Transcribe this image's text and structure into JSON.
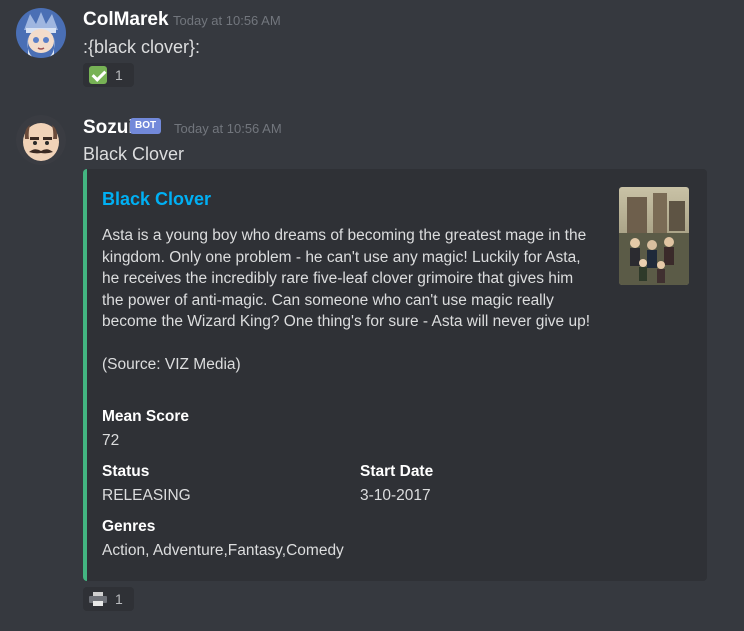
{
  "messages": [
    {
      "username": "ColMarek",
      "timestamp": "Today at 10:56 AM",
      "content": ":{black clover}:",
      "reaction": {
        "icon": "check-mark-button-icon",
        "count": "1"
      }
    },
    {
      "username": "Sozui",
      "bot_tag": "BOT",
      "timestamp": "Today at 10:56 AM",
      "content": "Black Clover",
      "embed": {
        "accent_color": "#43b581",
        "title": "Black Clover",
        "description": "Asta is a young boy who dreams of becoming the greatest mage in the kingdom. Only one problem - he can't use any magic! Luckily for Asta, he receives the incredibly rare five-leaf clover grimoire that gives him the power of anti-magic. Can someone who can't use magic really become the Wizard King? One thing's for sure - Asta will never give up!",
        "source": "(Source: VIZ Media)",
        "fields": {
          "mean_score": {
            "name": "Mean Score",
            "value": "72"
          },
          "status": {
            "name": "Status",
            "value": "RELEASING"
          },
          "start_date": {
            "name": "Start Date",
            "value": "3-10-2017"
          },
          "genres": {
            "name": "Genres",
            "value": "Action, Adventure,Fantasy,Comedy"
          }
        },
        "thumbnail": "anime-cover-thumbnail"
      },
      "reaction": {
        "icon": "printer-icon",
        "count": "1"
      }
    }
  ],
  "colors": {
    "background": "#36393f",
    "embed_background": "#2f3136",
    "link_title": "#00b0f4",
    "bot_tag": "#7289da"
  }
}
